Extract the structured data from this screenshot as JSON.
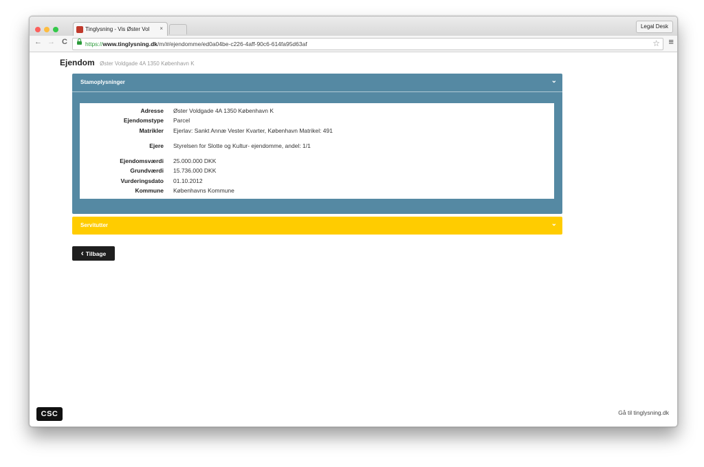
{
  "browser": {
    "tab_title": "Tinglysning - Vis Øster Vol",
    "tab_close": "×",
    "profile_button": "Legal Desk",
    "url_scheme": "https://",
    "url_host": "www.tinglysning.dk",
    "url_path": "/m/#/ejendomme/ed0a04be-c226-4aff-90c6-614fa95d63af",
    "nav_back": "←",
    "nav_forward": "→",
    "nav_reload": "C",
    "star": "☆",
    "menu": "≡"
  },
  "page": {
    "title": "Ejendom",
    "subtitle": "Øster Voldgade 4A 1350 København K"
  },
  "stamoplysninger": {
    "title": "Stamoplysninger",
    "chevron": "⌄",
    "fields": [
      {
        "label": "Adresse",
        "value": "Øster Voldgade 4A 1350 København K"
      },
      {
        "label": "Ejendomstype",
        "value": "Parcel"
      },
      {
        "label": "Matrikler",
        "value": "Ejerlav: Sankt Annæ Vester Kvarter, København Matrikel: 491"
      },
      {
        "label": "Ejere",
        "value": "Styrelsen for Slotte og Kultur- ejendomme, andel: 1/1"
      },
      {
        "label": "Ejendomsværdi",
        "value": "25.000.000 DKK"
      },
      {
        "label": "Grundværdi",
        "value": "15.736.000 DKK"
      },
      {
        "label": "Vurderingsdato",
        "value": "01.10.2012"
      },
      {
        "label": "Kommune",
        "value": "Københavns Kommune"
      }
    ]
  },
  "servitutter": {
    "title": "Servitutter",
    "chevron": "⌄"
  },
  "back_button": {
    "icon": "‹",
    "label": "Tilbage"
  },
  "footer": {
    "logo_text": "CSC",
    "link": "Gå til tinglysning.dk"
  },
  "colors": {
    "panel_blue": "#5589a3",
    "panel_yellow": "#ffcc00",
    "button_dark": "#1f1f1f"
  }
}
